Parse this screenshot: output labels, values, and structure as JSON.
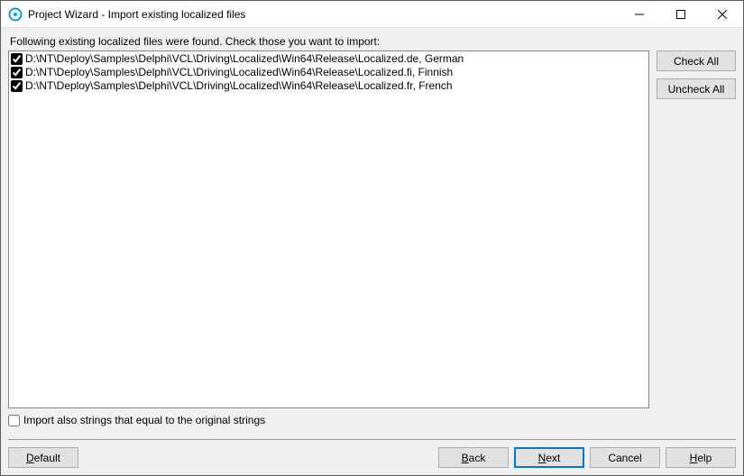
{
  "window": {
    "title": "Project Wizard - Import existing localized files"
  },
  "instruction": "Following existing localized files were found. Check those you want to import:",
  "files": [
    {
      "checked": true,
      "label": "D:\\NT\\Deploy\\Samples\\Delphi\\VCL\\Driving\\Localized\\Win64\\Release\\Localized.de, German"
    },
    {
      "checked": true,
      "label": "D:\\NT\\Deploy\\Samples\\Delphi\\VCL\\Driving\\Localized\\Win64\\Release\\Localized.fi, Finnish"
    },
    {
      "checked": true,
      "label": "D:\\NT\\Deploy\\Samples\\Delphi\\VCL\\Driving\\Localized\\Win64\\Release\\Localized.fr, French"
    }
  ],
  "side_buttons": {
    "check_all": "Check All",
    "uncheck_all": "Uncheck All"
  },
  "import_equal": {
    "checked": false,
    "label": "Import also strings that equal to the original strings"
  },
  "footer": {
    "default_pre": "",
    "default_m": "D",
    "default_post": "efault",
    "back_pre": "",
    "back_m": "B",
    "back_post": "ack",
    "next_pre": "",
    "next_m": "N",
    "next_post": "ext",
    "cancel": "Cancel",
    "help_pre": "",
    "help_m": "H",
    "help_post": "elp"
  }
}
